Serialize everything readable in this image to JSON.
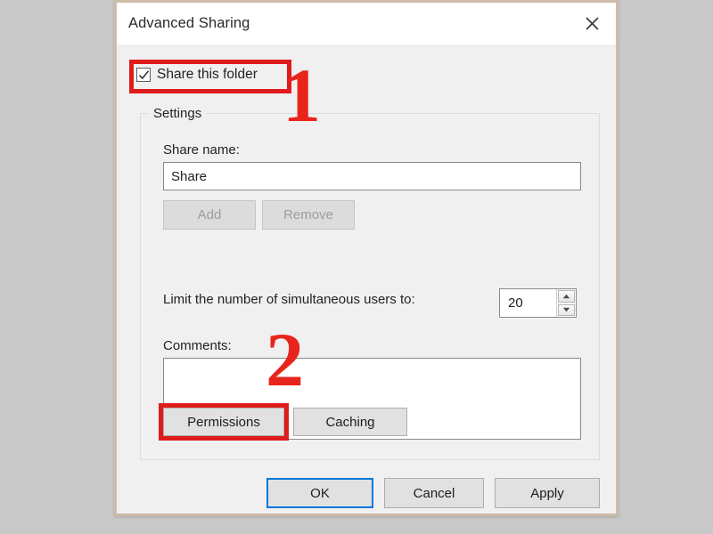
{
  "dialog": {
    "title": "Advanced Sharing",
    "close_icon": "close-icon"
  },
  "share_folder": {
    "label": "Share this folder",
    "checked": true,
    "check_icon": "checkmark-icon"
  },
  "settings": {
    "legend": "Settings",
    "share_name": {
      "label": "Share name:",
      "value": "Share",
      "placeholder": ""
    },
    "add_button": "Add",
    "remove_button": "Remove",
    "limit": {
      "label": "Limit the number of simultaneous users to:",
      "value": "20",
      "up_icon": "triangle-up-icon",
      "down_icon": "triangle-down-icon"
    },
    "comments": {
      "label": "Comments:",
      "value": "",
      "placeholder": ""
    },
    "permissions_button": "Permissions",
    "caching_button": "Caching"
  },
  "footer": {
    "ok_label": "OK",
    "cancel_label": "Cancel",
    "apply_label": "Apply"
  },
  "annotations": {
    "step_one": "1",
    "step_two": "2",
    "highlight_color": "#e01b1b",
    "number_color": "#e8251c"
  },
  "colors": {
    "page_background": "#c9c9c9",
    "dialog_border": "#cdbca9",
    "titlebar_background": "#ffffff",
    "body_background": "#f0f0f0",
    "focus_border": "#0078d7"
  }
}
